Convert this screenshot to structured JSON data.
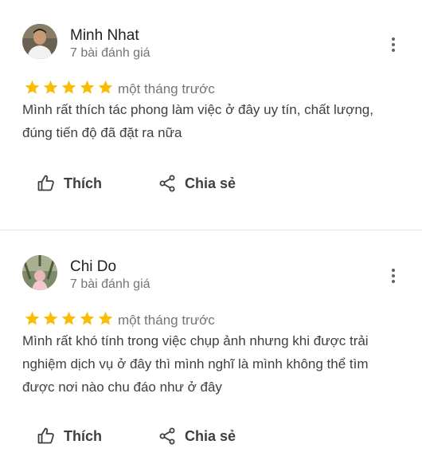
{
  "reviews": [
    {
      "name": "Minh Nhat",
      "review_count": "7 bài đánh giá",
      "rating": 5,
      "time": "một tháng trước",
      "text": "Mình rất thích tác phong làm việc ở đây uy tín, chất lượng, đúng tiến độ đã đặt ra nữa",
      "like_label": "Thích",
      "share_label": "Chia sẻ"
    },
    {
      "name": "Chi Do",
      "review_count": "7 bài đánh giá",
      "rating": 5,
      "time": "một tháng trước",
      "text": "Mình rất khó tính trong việc chụp ảnh nhưng khi được trải nghiệm dịch vụ ở đây thì mình nghĩ là mình không thể tìm được nơi nào chu đáo như ở đây",
      "like_label": "Thích",
      "share_label": "Chia sẻ"
    }
  ],
  "colors": {
    "star": "#fbbc04",
    "secondary_text": "#70757a",
    "divider": "#e4e4e4"
  },
  "icons": {
    "rating": "star-icon",
    "like": "thumbs-up-icon",
    "share": "share-icon",
    "menu": "more-vert-icon"
  }
}
